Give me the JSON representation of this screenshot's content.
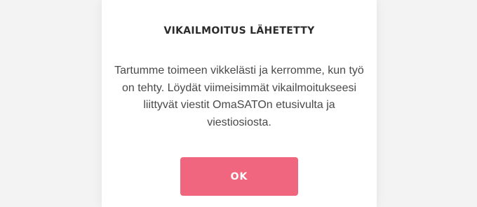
{
  "dialog": {
    "title": "VIKAILMOITUS LÄHETETTY",
    "message": "Tartumme toimeen vikkelästi ja kerromme, kun työ on tehty. Löydät viimeisimmät vikailmoitukseesi liittyvät viestit OmaSATOn etusivulta ja viestiosiosta.",
    "ok_label": "OK"
  },
  "colors": {
    "background": "#f3f3f3",
    "card": "#ffffff",
    "title_text": "#2b2b2b",
    "body_text": "#4a4a4a",
    "button": "#f0667e",
    "button_text": "#ffffff"
  }
}
